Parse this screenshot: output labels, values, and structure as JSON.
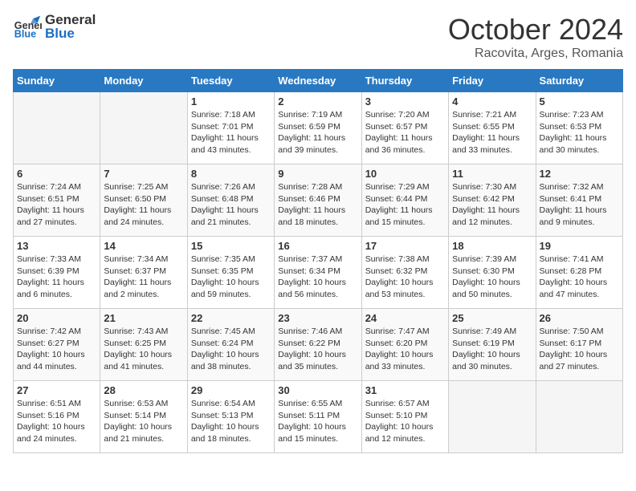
{
  "header": {
    "logo_general": "General",
    "logo_blue": "Blue",
    "month": "October 2024",
    "location": "Racovita, Arges, Romania"
  },
  "days_of_week": [
    "Sunday",
    "Monday",
    "Tuesday",
    "Wednesday",
    "Thursday",
    "Friday",
    "Saturday"
  ],
  "weeks": [
    [
      {
        "day": "",
        "sunrise": "",
        "sunset": "",
        "daylight": ""
      },
      {
        "day": "",
        "sunrise": "",
        "sunset": "",
        "daylight": ""
      },
      {
        "day": "1",
        "sunrise": "Sunrise: 7:18 AM",
        "sunset": "Sunset: 7:01 PM",
        "daylight": "Daylight: 11 hours and 43 minutes."
      },
      {
        "day": "2",
        "sunrise": "Sunrise: 7:19 AM",
        "sunset": "Sunset: 6:59 PM",
        "daylight": "Daylight: 11 hours and 39 minutes."
      },
      {
        "day": "3",
        "sunrise": "Sunrise: 7:20 AM",
        "sunset": "Sunset: 6:57 PM",
        "daylight": "Daylight: 11 hours and 36 minutes."
      },
      {
        "day": "4",
        "sunrise": "Sunrise: 7:21 AM",
        "sunset": "Sunset: 6:55 PM",
        "daylight": "Daylight: 11 hours and 33 minutes."
      },
      {
        "day": "5",
        "sunrise": "Sunrise: 7:23 AM",
        "sunset": "Sunset: 6:53 PM",
        "daylight": "Daylight: 11 hours and 30 minutes."
      }
    ],
    [
      {
        "day": "6",
        "sunrise": "Sunrise: 7:24 AM",
        "sunset": "Sunset: 6:51 PM",
        "daylight": "Daylight: 11 hours and 27 minutes."
      },
      {
        "day": "7",
        "sunrise": "Sunrise: 7:25 AM",
        "sunset": "Sunset: 6:50 PM",
        "daylight": "Daylight: 11 hours and 24 minutes."
      },
      {
        "day": "8",
        "sunrise": "Sunrise: 7:26 AM",
        "sunset": "Sunset: 6:48 PM",
        "daylight": "Daylight: 11 hours and 21 minutes."
      },
      {
        "day": "9",
        "sunrise": "Sunrise: 7:28 AM",
        "sunset": "Sunset: 6:46 PM",
        "daylight": "Daylight: 11 hours and 18 minutes."
      },
      {
        "day": "10",
        "sunrise": "Sunrise: 7:29 AM",
        "sunset": "Sunset: 6:44 PM",
        "daylight": "Daylight: 11 hours and 15 minutes."
      },
      {
        "day": "11",
        "sunrise": "Sunrise: 7:30 AM",
        "sunset": "Sunset: 6:42 PM",
        "daylight": "Daylight: 11 hours and 12 minutes."
      },
      {
        "day": "12",
        "sunrise": "Sunrise: 7:32 AM",
        "sunset": "Sunset: 6:41 PM",
        "daylight": "Daylight: 11 hours and 9 minutes."
      }
    ],
    [
      {
        "day": "13",
        "sunrise": "Sunrise: 7:33 AM",
        "sunset": "Sunset: 6:39 PM",
        "daylight": "Daylight: 11 hours and 6 minutes."
      },
      {
        "day": "14",
        "sunrise": "Sunrise: 7:34 AM",
        "sunset": "Sunset: 6:37 PM",
        "daylight": "Daylight: 11 hours and 2 minutes."
      },
      {
        "day": "15",
        "sunrise": "Sunrise: 7:35 AM",
        "sunset": "Sunset: 6:35 PM",
        "daylight": "Daylight: 10 hours and 59 minutes."
      },
      {
        "day": "16",
        "sunrise": "Sunrise: 7:37 AM",
        "sunset": "Sunset: 6:34 PM",
        "daylight": "Daylight: 10 hours and 56 minutes."
      },
      {
        "day": "17",
        "sunrise": "Sunrise: 7:38 AM",
        "sunset": "Sunset: 6:32 PM",
        "daylight": "Daylight: 10 hours and 53 minutes."
      },
      {
        "day": "18",
        "sunrise": "Sunrise: 7:39 AM",
        "sunset": "Sunset: 6:30 PM",
        "daylight": "Daylight: 10 hours and 50 minutes."
      },
      {
        "day": "19",
        "sunrise": "Sunrise: 7:41 AM",
        "sunset": "Sunset: 6:28 PM",
        "daylight": "Daylight: 10 hours and 47 minutes."
      }
    ],
    [
      {
        "day": "20",
        "sunrise": "Sunrise: 7:42 AM",
        "sunset": "Sunset: 6:27 PM",
        "daylight": "Daylight: 10 hours and 44 minutes."
      },
      {
        "day": "21",
        "sunrise": "Sunrise: 7:43 AM",
        "sunset": "Sunset: 6:25 PM",
        "daylight": "Daylight: 10 hours and 41 minutes."
      },
      {
        "day": "22",
        "sunrise": "Sunrise: 7:45 AM",
        "sunset": "Sunset: 6:24 PM",
        "daylight": "Daylight: 10 hours and 38 minutes."
      },
      {
        "day": "23",
        "sunrise": "Sunrise: 7:46 AM",
        "sunset": "Sunset: 6:22 PM",
        "daylight": "Daylight: 10 hours and 35 minutes."
      },
      {
        "day": "24",
        "sunrise": "Sunrise: 7:47 AM",
        "sunset": "Sunset: 6:20 PM",
        "daylight": "Daylight: 10 hours and 33 minutes."
      },
      {
        "day": "25",
        "sunrise": "Sunrise: 7:49 AM",
        "sunset": "Sunset: 6:19 PM",
        "daylight": "Daylight: 10 hours and 30 minutes."
      },
      {
        "day": "26",
        "sunrise": "Sunrise: 7:50 AM",
        "sunset": "Sunset: 6:17 PM",
        "daylight": "Daylight: 10 hours and 27 minutes."
      }
    ],
    [
      {
        "day": "27",
        "sunrise": "Sunrise: 6:51 AM",
        "sunset": "Sunset: 5:16 PM",
        "daylight": "Daylight: 10 hours and 24 minutes."
      },
      {
        "day": "28",
        "sunrise": "Sunrise: 6:53 AM",
        "sunset": "Sunset: 5:14 PM",
        "daylight": "Daylight: 10 hours and 21 minutes."
      },
      {
        "day": "29",
        "sunrise": "Sunrise: 6:54 AM",
        "sunset": "Sunset: 5:13 PM",
        "daylight": "Daylight: 10 hours and 18 minutes."
      },
      {
        "day": "30",
        "sunrise": "Sunrise: 6:55 AM",
        "sunset": "Sunset: 5:11 PM",
        "daylight": "Daylight: 10 hours and 15 minutes."
      },
      {
        "day": "31",
        "sunrise": "Sunrise: 6:57 AM",
        "sunset": "Sunset: 5:10 PM",
        "daylight": "Daylight: 10 hours and 12 minutes."
      },
      {
        "day": "",
        "sunrise": "",
        "sunset": "",
        "daylight": ""
      },
      {
        "day": "",
        "sunrise": "",
        "sunset": "",
        "daylight": ""
      }
    ]
  ]
}
